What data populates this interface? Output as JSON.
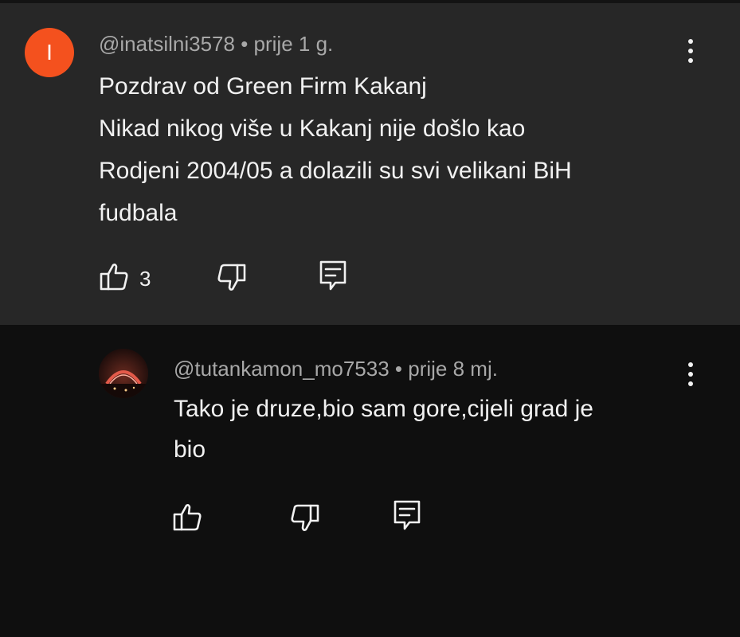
{
  "comment": {
    "avatar_letter": "I",
    "author": "@inatsilni3578",
    "separator": "•",
    "time": "prije 1 g.",
    "lines": [
      "Pozdrav od Green Firm Kakanj",
      "Nikad nikog više u Kakanj nije došlo kao",
      "Rodjeni 2004/05 a dolazili su svi velikani BiH",
      "fudbala"
    ],
    "like_count": "3",
    "icons": [
      "thumbs-up-icon",
      "thumbs-down-icon",
      "reply-icon",
      "more-vert-icon"
    ]
  },
  "reply": {
    "author": "@tutankamon_mo7533",
    "separator": "•",
    "time": "prije 8 mj.",
    "lines": [
      "Tako je druze,bio sam gore,cijeli grad je",
      "bio"
    ],
    "icons": [
      "thumbs-up-icon",
      "thumbs-down-icon",
      "reply-icon",
      "more-vert-icon"
    ]
  },
  "colors": {
    "comment_bg": "#272727",
    "page_bg": "#0f0f0f",
    "avatar_bg": "#f4511e",
    "meta_text": "#a8a8a8",
    "body_text": "#f1f1f1"
  }
}
